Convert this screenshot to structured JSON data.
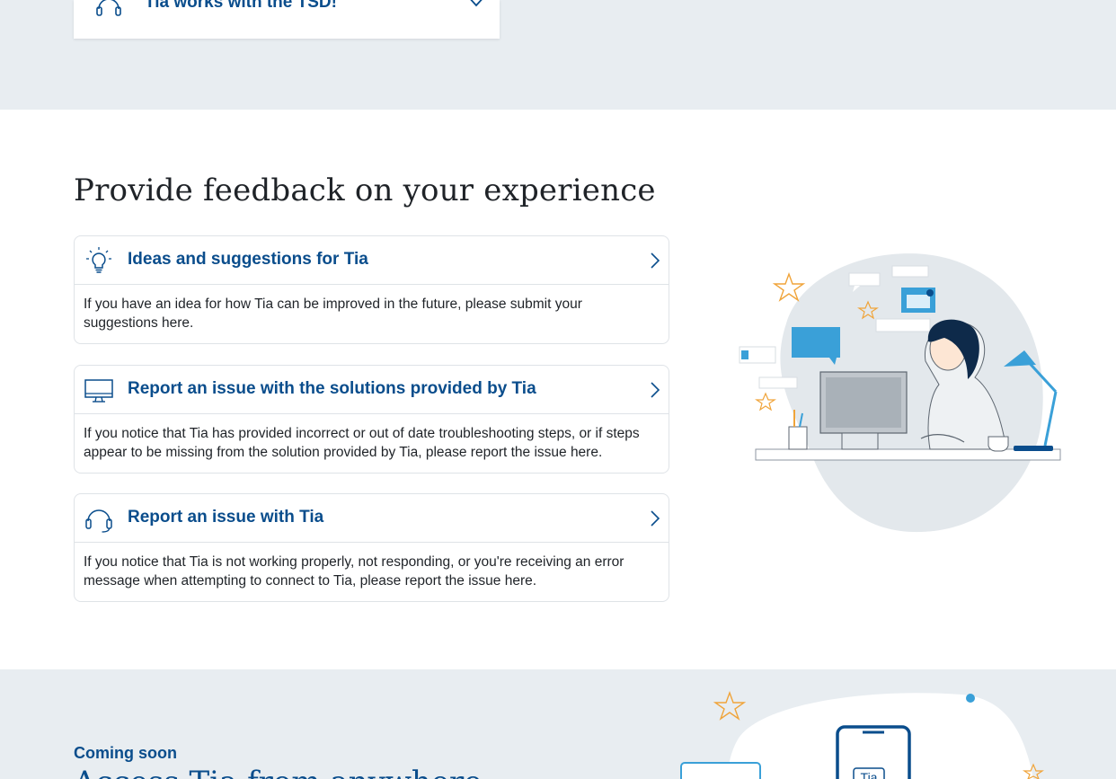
{
  "accordion": {
    "label": "Tia works with the TSD!",
    "icon": "headset-icon"
  },
  "feedback": {
    "title": "Provide feedback on your experience",
    "cards": [
      {
        "icon": "lightbulb-icon",
        "title": "Ideas and suggestions for Tia",
        "body": "If you have an idea for how Tia can be improved in the future, please submit your suggestions here."
      },
      {
        "icon": "monitor-icon",
        "title": "Report an issue with the solutions provided by Tia",
        "body": "If you notice that Tia has provided incorrect or out of date troubleshooting steps, or if steps appear to be missing from the solution provided by Tia, please report the issue here."
      },
      {
        "icon": "headset-icon",
        "title": "Report an issue with Tia",
        "body": "If you notice that Tia is not working properly, not responding, or you're receiving an error message when attempting to connect to Tia, please report the issue here."
      }
    ]
  },
  "coming_soon": {
    "eyebrow": "Coming soon",
    "title": "Access Tia from anywhere",
    "phone_label": "Tia"
  },
  "colors": {
    "brand_blue": "#0a4d8c",
    "band_gray": "#e8edf1",
    "border": "#dfe3e7",
    "accent_light_blue": "#3aa0d8",
    "star_orange": "#f0a43a"
  }
}
